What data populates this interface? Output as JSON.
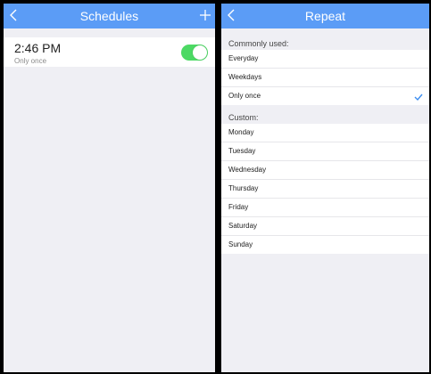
{
  "left_screen": {
    "title": "Schedules",
    "schedule": {
      "time": "2:46 PM",
      "repeat": "Only once",
      "enabled": true
    }
  },
  "right_screen": {
    "title": "Repeat",
    "common_header": "Commonly used:",
    "common_options": [
      "Everyday",
      "Weekdays",
      "Only once"
    ],
    "selected": "Only once",
    "custom_header": "Custom:",
    "custom_options": [
      "Monday",
      "Tuesday",
      "Wednesday",
      "Thursday",
      "Friday",
      "Saturday",
      "Sunday"
    ]
  },
  "colors": {
    "navbar": "#5b9cf6",
    "toggle_on": "#4cd964",
    "checkmark": "#3d8ef0",
    "background": "#efeff4"
  },
  "icons": {
    "back": "chevron-left-icon",
    "add": "plus-icon",
    "check": "checkmark-icon"
  }
}
